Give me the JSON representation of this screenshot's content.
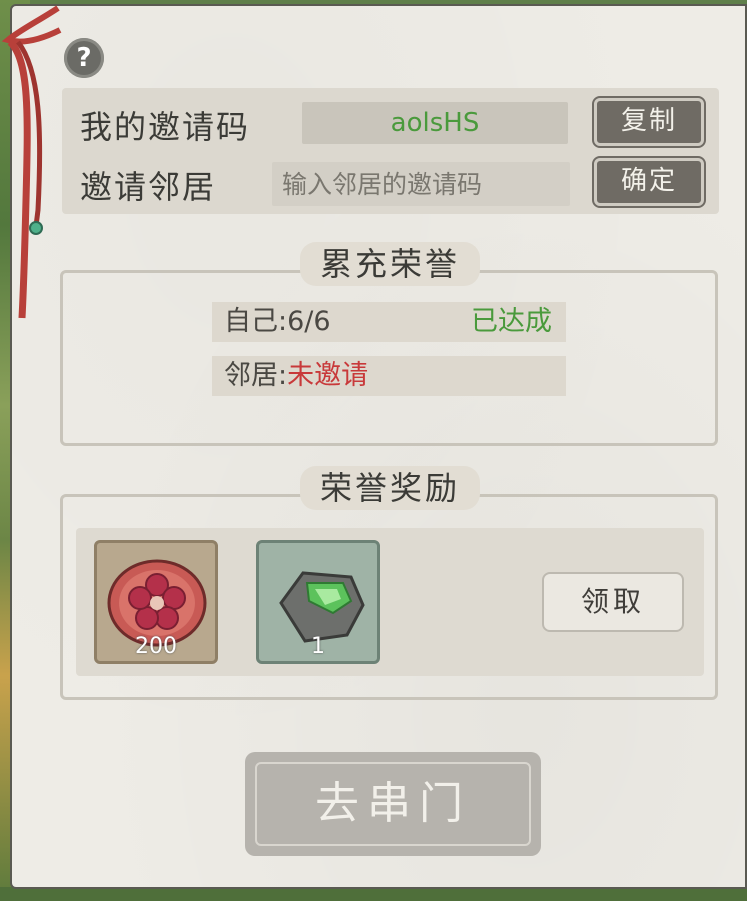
{
  "invite": {
    "my_code_label": "我的邀请码",
    "my_code": "aolsHS",
    "copy_label": "复制",
    "invite_neighbor_label": "邀请邻居",
    "input_placeholder": "输入邻居的邀请码",
    "confirm_label": "确定"
  },
  "honor": {
    "title": "累充荣誉",
    "self_label": "自己:",
    "self_value": "6/6",
    "self_status": "已达成",
    "neighbor_label": "邻居:",
    "neighbor_status": "未邀请"
  },
  "rewards": {
    "title": "荣誉奖励",
    "items": [
      {
        "icon": "plum-blossom-token-icon",
        "count": "200"
      },
      {
        "icon": "jade-stone-icon",
        "count": "1"
      }
    ],
    "claim_label": "领取"
  },
  "go_button_label": "去串门",
  "colors": {
    "achieved": "#4a9a3c",
    "not_invited": "#c8393a",
    "code_text": "#4a9a3c"
  }
}
